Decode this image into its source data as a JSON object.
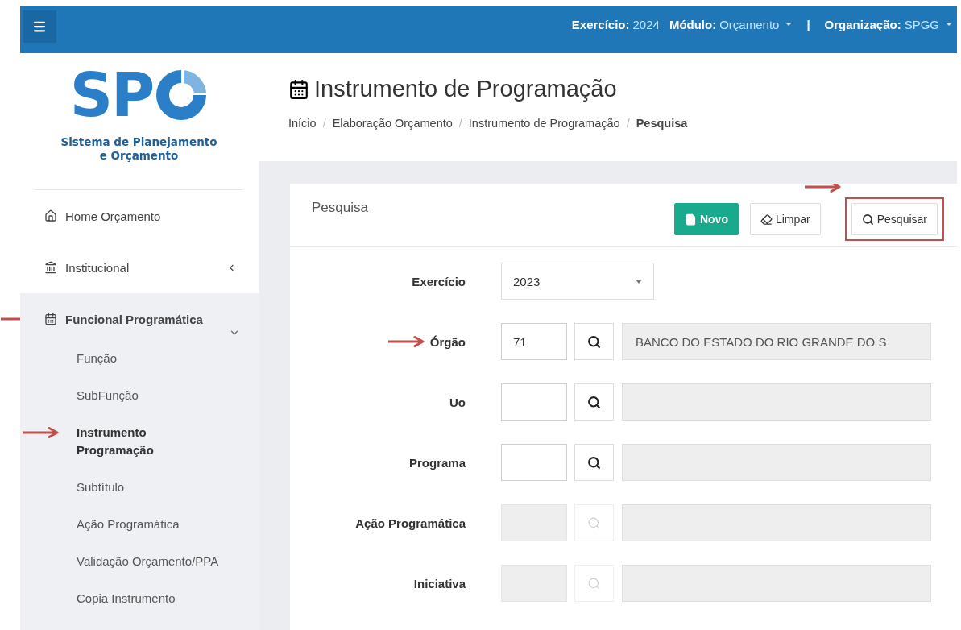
{
  "top_bar": {
    "items": [
      {
        "kind": "field",
        "label": "Exercício:",
        "value": "2024",
        "dropdown": false
      },
      {
        "kind": "field",
        "label": "Módulo:",
        "value": "Orçamento",
        "dropdown": true
      },
      {
        "kind": "separator",
        "label": "|"
      },
      {
        "kind": "field",
        "label": "Organização:",
        "value": "SPGG",
        "dropdown": true
      }
    ]
  },
  "sidebar": {
    "logo": {
      "mark": "SP",
      "lines": [
        "Sistema de Planejamento",
        "e Orçamento"
      ]
    },
    "menu": [
      {
        "label": "Home Orçamento",
        "arrow": false
      },
      {
        "label": "Institucional",
        "expanded": false,
        "arrow": false
      },
      {
        "label": "Funcional Programática",
        "expanded": true,
        "arrow": true,
        "children": [
          {
            "label": "Função",
            "selected": false,
            "arrow": false
          },
          {
            "label": "SubFunção",
            "selected": false,
            "arrow": false
          },
          {
            "label": "Instrumento\nProgramação",
            "selected": true,
            "arrow": true
          },
          {
            "label": "Subtítulo",
            "selected": false,
            "arrow": false
          },
          {
            "label": "Ação Programática",
            "selected": false,
            "arrow": false
          },
          {
            "label": "Validação Orçamento/PPA",
            "selected": false,
            "arrow": false
          },
          {
            "label": "Copia Instrumento",
            "selected": false,
            "arrow": false
          }
        ]
      }
    ]
  },
  "page": {
    "title": "Instrumento de Programação",
    "breadcrumb": [
      {
        "label": "Início",
        "current": false
      },
      {
        "separator": "/",
        "label": "Elaboração Orçamento",
        "current": false
      },
      {
        "separator": "/",
        "label": "Instrumento de Programação",
        "current": false
      },
      {
        "separator": "/",
        "label": "Pesquisa",
        "current": true
      }
    ]
  },
  "panel": {
    "heading": "Pesquisa",
    "buttons": [
      {
        "label": "Novo",
        "kind": "primary",
        "highlighted": false
      },
      {
        "label": "Limpar",
        "kind": "clear",
        "highlighted": false
      },
      {
        "label": "Pesquisar",
        "kind": "search",
        "highlighted": true
      }
    ],
    "fields": [
      {
        "label": "Exercício",
        "kind": "select",
        "value": "2023",
        "disabled": false,
        "arrow": false
      },
      {
        "label": "Órgão",
        "kind": "lookup",
        "value": "71",
        "description": "BANCO DO ESTADO DO RIO GRANDE DO S",
        "disabled": false,
        "arrow": true
      },
      {
        "label": "Uo",
        "kind": "lookup",
        "disabled": false,
        "arrow": false
      },
      {
        "label": "Programa",
        "kind": "lookup",
        "disabled": false,
        "arrow": false
      },
      {
        "label": "Ação Programática",
        "kind": "lookup",
        "disabled": true,
        "arrow": false
      },
      {
        "label": "Iniciativa",
        "kind": "lookup",
        "disabled": true,
        "arrow": false
      }
    ]
  }
}
